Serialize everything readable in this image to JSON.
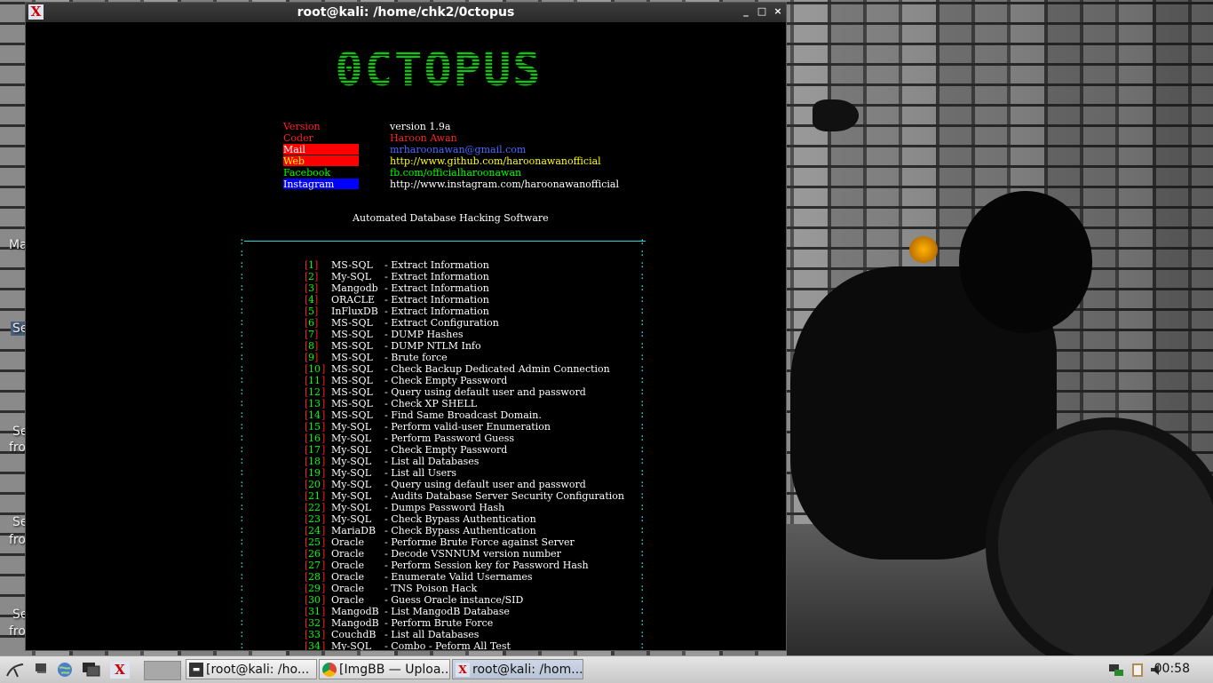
{
  "window": {
    "title": "root@kali: /home/chk2/0ctopus",
    "minimize": "_",
    "maximize": "□",
    "close": "×",
    "icon": "kali-x-icon"
  },
  "desktop": {
    "labels": [
      "Ma",
      "Se",
      "Se",
      "fro",
      "Se",
      "fro",
      "Se",
      "fro"
    ]
  },
  "terminal": {
    "banner": "0CTOPUS",
    "info": [
      {
        "label": "Version",
        "value": "version 1.9a",
        "label_color": "#ff2020",
        "label_bg": "",
        "value_color": "#ffffff"
      },
      {
        "label": "Coder",
        "value": "Haroon Awan",
        "label_color": "#ff2020",
        "label_bg": "",
        "value_color": "#ff2020"
      },
      {
        "label": "Mail",
        "value": "mrharoonawan@gmail.com",
        "label_color": "#ffffff",
        "label_bg": "#ff0000",
        "value_color": "#4a6aff"
      },
      {
        "label": "Web",
        "value": "http://www.github.com/haroonawanofficial",
        "label_color": "#ffff00",
        "label_bg": "#ff0000",
        "value_color": "#ffff00"
      },
      {
        "label": "Facebook",
        "value": "fb.com/officialharoonawan",
        "label_color": "#00ff00",
        "label_bg": "",
        "value_color": "#00ff00"
      },
      {
        "label": "Instagram",
        "value": "http://www.instagram.com/haroonawanofficial",
        "label_color": "#ffffff",
        "label_bg": "#0000ff",
        "value_color": "#ffffff"
      }
    ],
    "subtitle": "Automated Database Hacking Software",
    "menu": [
      {
        "n": "1",
        "db": "MS-SQL",
        "action": "- Extract Information"
      },
      {
        "n": "2",
        "db": "My-SQL",
        "action": "- Extract Information"
      },
      {
        "n": "3",
        "db": "Mangodb",
        "action": "- Extract Information"
      },
      {
        "n": "4",
        "db": "ORACLE",
        "action": "- Extract Information"
      },
      {
        "n": "5",
        "db": "InFluxDB",
        "action": "- Extract Information"
      },
      {
        "n": "6",
        "db": "MS-SQL",
        "action": "- Extract Configuration"
      },
      {
        "n": "7",
        "db": "MS-SQL",
        "action": "- DUMP Hashes"
      },
      {
        "n": "8",
        "db": "MS-SQL",
        "action": "- DUMP NTLM Info"
      },
      {
        "n": "9",
        "db": "MS-SQL",
        "action": "- Brute force"
      },
      {
        "n": "10",
        "db": "MS-SQL",
        "action": "- Check Backup Dedicated Admin Connection"
      },
      {
        "n": "11",
        "db": "MS-SQL",
        "action": "- Check Empty Password"
      },
      {
        "n": "12",
        "db": "MS-SQL",
        "action": "- Query using default user and password"
      },
      {
        "n": "13",
        "db": "MS-SQL",
        "action": "- Check XP SHELL"
      },
      {
        "n": "14",
        "db": "MS-SQL",
        "action": "- Find Same Broadcast Domain."
      },
      {
        "n": "15",
        "db": "My-SQL",
        "action": "- Perform valid-user Enumeration"
      },
      {
        "n": "16",
        "db": "My-SQL",
        "action": "- Perform Password Guess"
      },
      {
        "n": "17",
        "db": "My-SQL",
        "action": "- Check Empty Password"
      },
      {
        "n": "18",
        "db": "My-SQL",
        "action": "- List all Databases"
      },
      {
        "n": "19",
        "db": "My-SQL",
        "action": "- List all Users"
      },
      {
        "n": "20",
        "db": "My-SQL",
        "action": "- Query using default user and password"
      },
      {
        "n": "21",
        "db": "My-SQL",
        "action": "- Audits Database Server Security Configuration"
      },
      {
        "n": "22",
        "db": "My-SQL",
        "action": "- Dumps Password Hash"
      },
      {
        "n": "23",
        "db": "My-SQL",
        "action": "- Check Bypass Authentication"
      },
      {
        "n": "24",
        "db": "MariaDB",
        "action": "- Check Bypass Authentication"
      },
      {
        "n": "25",
        "db": "Oracle",
        "action": "- Performe Brute Force against Server"
      },
      {
        "n": "26",
        "db": "Oracle",
        "action": "- Decode VSNNUM version number"
      },
      {
        "n": "27",
        "db": "Oracle",
        "action": "- Perform Session key for Password Hash"
      },
      {
        "n": "28",
        "db": "Oracle",
        "action": "- Enumerate Valid Usernames"
      },
      {
        "n": "29",
        "db": "Oracle",
        "action": "- TNS Poison Hack"
      },
      {
        "n": "30",
        "db": "Oracle",
        "action": "- Guess Oracle instance/SID"
      },
      {
        "n": "31",
        "db": "MangodB",
        "action": "- List MangodB Database"
      },
      {
        "n": "32",
        "db": "MangodB",
        "action": "- Perform Brute Force"
      },
      {
        "n": "33",
        "db": "CouchdB",
        "action": "- List all Databases"
      },
      {
        "n": "34",
        "db": "My-SQL",
        "action": "- Combo - Peform All Test"
      }
    ]
  },
  "taskbar": {
    "launchers": [
      "kali-menu-icon",
      "show-desktop-icon",
      "network-globe-icon",
      "file-manager-icon",
      "kali-x-icon"
    ],
    "tasks": [
      {
        "label": "[root@kali: /ho...",
        "icon": "terminal-icon"
      },
      {
        "label": "[ImgBB — Uploa...",
        "icon": "chrome-icon"
      },
      {
        "label": "root@kali: /hom...",
        "icon": "kali-x-icon"
      }
    ],
    "clock": "00:58"
  }
}
